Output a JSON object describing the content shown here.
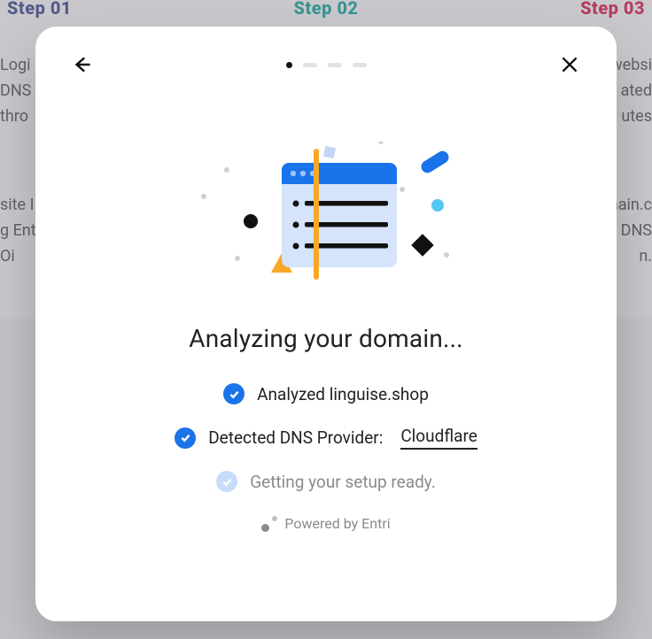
{
  "background": {
    "steps": [
      {
        "label": "Step 01"
      },
      {
        "label": "Step 02"
      },
      {
        "label": "Step 03"
      }
    ],
    "left_snip_top": "Logi\nDNS\nthro",
    "right_snip_top": "websi\nated\nutes",
    "left_snip_mid": "site I\ng Ent\nOi",
    "right_snip_mid": "nain.c\nDNS\nn."
  },
  "modal": {
    "progress": {
      "total": 4,
      "active_index": 0
    },
    "title": "Analyzing your domain...",
    "items": [
      {
        "done": true,
        "label": "Analyzed linguise.shop"
      },
      {
        "done": true,
        "label_prefix": "Detected DNS Provider:",
        "value": "Cloudflare"
      },
      {
        "done": false,
        "label": "Getting your setup ready."
      }
    ],
    "footer": "Powered by Entri"
  }
}
